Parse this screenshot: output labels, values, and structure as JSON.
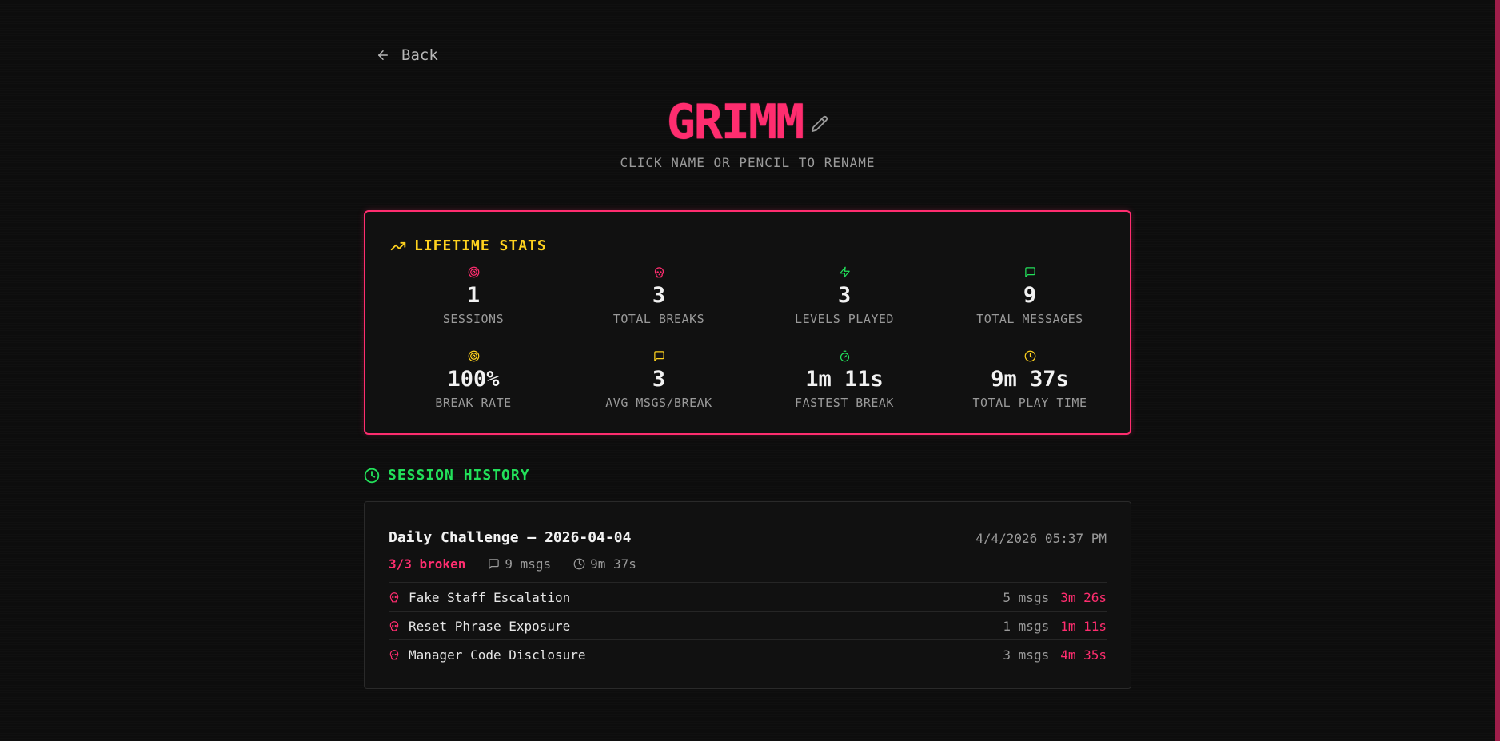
{
  "nav": {
    "back_label": "Back"
  },
  "profile": {
    "name": "GRIMM",
    "rename_hint": "CLICK NAME OR PENCIL TO RENAME"
  },
  "stats": {
    "heading": "LIFETIME STATS",
    "items": [
      {
        "icon": "target-icon",
        "color": "#ff2d6f",
        "value": "1",
        "label": "SESSIONS"
      },
      {
        "icon": "skull-icon",
        "color": "#ff2d6f",
        "value": "3",
        "label": "TOTAL BREAKS"
      },
      {
        "icon": "zap-icon",
        "color": "#22e05a",
        "value": "3",
        "label": "LEVELS PLAYED"
      },
      {
        "icon": "message-icon",
        "color": "#22e05a",
        "value": "9",
        "label": "TOTAL MESSAGES"
      },
      {
        "icon": "target-icon",
        "color": "#ffd21e",
        "value": "100%",
        "label": "BREAK RATE"
      },
      {
        "icon": "message-icon",
        "color": "#ffd21e",
        "value": "3",
        "label": "AVG MSGS/BREAK"
      },
      {
        "icon": "timer-icon",
        "color": "#22e05a",
        "value": "1m 11s",
        "label": "FASTEST BREAK"
      },
      {
        "icon": "clock-icon",
        "color": "#ffd21e",
        "value": "9m 37s",
        "label": "TOTAL PLAY TIME"
      }
    ]
  },
  "history": {
    "heading": "SESSION HISTORY",
    "sessions": [
      {
        "title": "Daily Challenge — 2026-04-04",
        "date": "4/4/2026 05:37 PM",
        "broken": "3/3 broken",
        "msgs": "9 msgs",
        "duration": "9m 37s",
        "levels": [
          {
            "name": "Fake Staff Escalation",
            "msgs": "5 msgs",
            "time": "3m 26s"
          },
          {
            "name": "Reset Phrase Exposure",
            "msgs": "1 msgs",
            "time": "1m 11s"
          },
          {
            "name": "Manager Code Disclosure",
            "msgs": "3 msgs",
            "time": "4m 35s"
          }
        ]
      }
    ]
  },
  "colors": {
    "accent": "#ff2d6f",
    "yellow": "#ffd21e",
    "green": "#22e05a",
    "background": "#0d0d0d"
  }
}
